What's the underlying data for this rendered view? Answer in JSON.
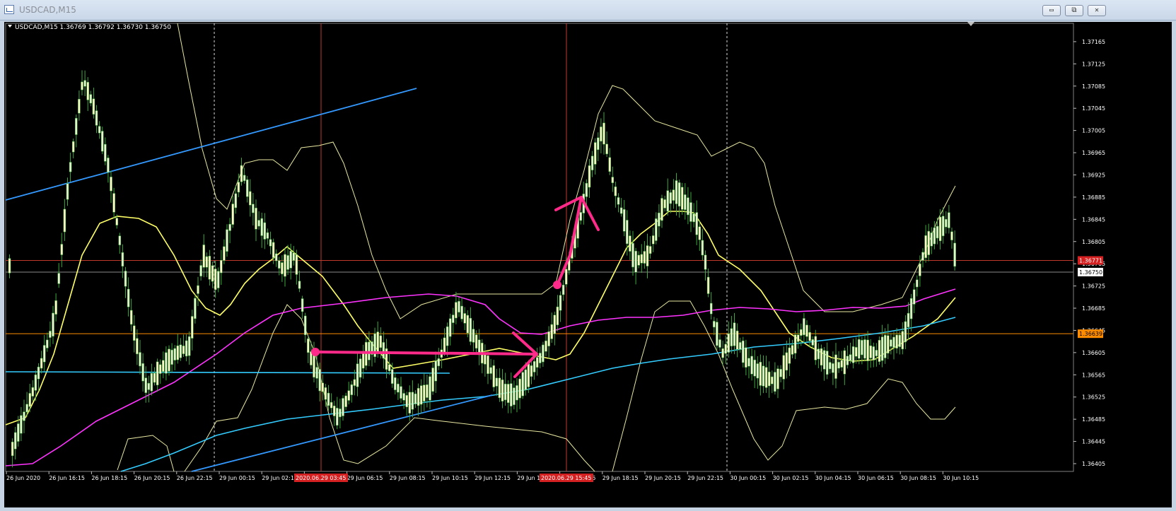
{
  "window": {
    "title": "USDCAD,M15",
    "buttons": [
      {
        "name": "minimize-button",
        "symbol": "▭"
      },
      {
        "name": "restore-button",
        "symbol": "⧉"
      },
      {
        "name": "close-button",
        "symbol": "✕"
      }
    ]
  },
  "chart": {
    "header": "USDCAD,M15  1.36769 1.36792 1.36730 1.36750",
    "price_labels": [
      "1.37165",
      "1.37125",
      "1.37085",
      "1.37045",
      "1.37005",
      "1.36965",
      "1.36925",
      "1.36885",
      "1.36845",
      "1.36805",
      "1.36765",
      "1.36725",
      "1.36685",
      "1.36645",
      "1.36605",
      "1.36565",
      "1.36525",
      "1.36485",
      "1.36445",
      "1.36405"
    ],
    "price_range": [
      1.36391,
      1.37198
    ],
    "current_price": "1.36750",
    "red_level": {
      "label": "1.36771",
      "price": 1.36771
    },
    "orange_level": {
      "label": "1.36639",
      "price": 1.36639
    },
    "time_labels": [
      "26 Jun 2020",
      "26 Jun 16:15",
      "26 Jun 18:15",
      "26 Jun 20:15",
      "26 Jun 22:15",
      "29 Jun 00:15",
      "29 Jun 02:15",
      "29 Jun 04:15",
      "29 Jun 06:15",
      "29 Jun 08:15",
      "29 Jun 10:15",
      "29 Jun 12:15",
      "29 Jun 14:15",
      "29 Jun 16:15",
      "29 Jun 18:15",
      "29 Jun 20:15",
      "29 Jun 22:15",
      "30 Jun 00:15",
      "30 Jun 02:15",
      "30 Jun 04:15",
      "30 Jun 06:15",
      "30 Jun 08:15",
      "30 Jun 10:15"
    ],
    "highlighted_time_labels": [
      "2020.06.29 03:45",
      "2020.06.29 15:45"
    ],
    "colors": {
      "background": "#000000",
      "candle_bull": "#ffffc8",
      "candle_bear": "#e8f7d0",
      "wick": "#3ea83e",
      "ma_fast": "#ffff66",
      "ma_mid": "#ff33ff",
      "ma_slow": "#33ccff",
      "bands": "#e8e8a0",
      "trendline": "#3399ff",
      "annotation": "#ff2a8a",
      "red_line": "#c0392b",
      "orange_line": "#ff8c00"
    }
  }
}
